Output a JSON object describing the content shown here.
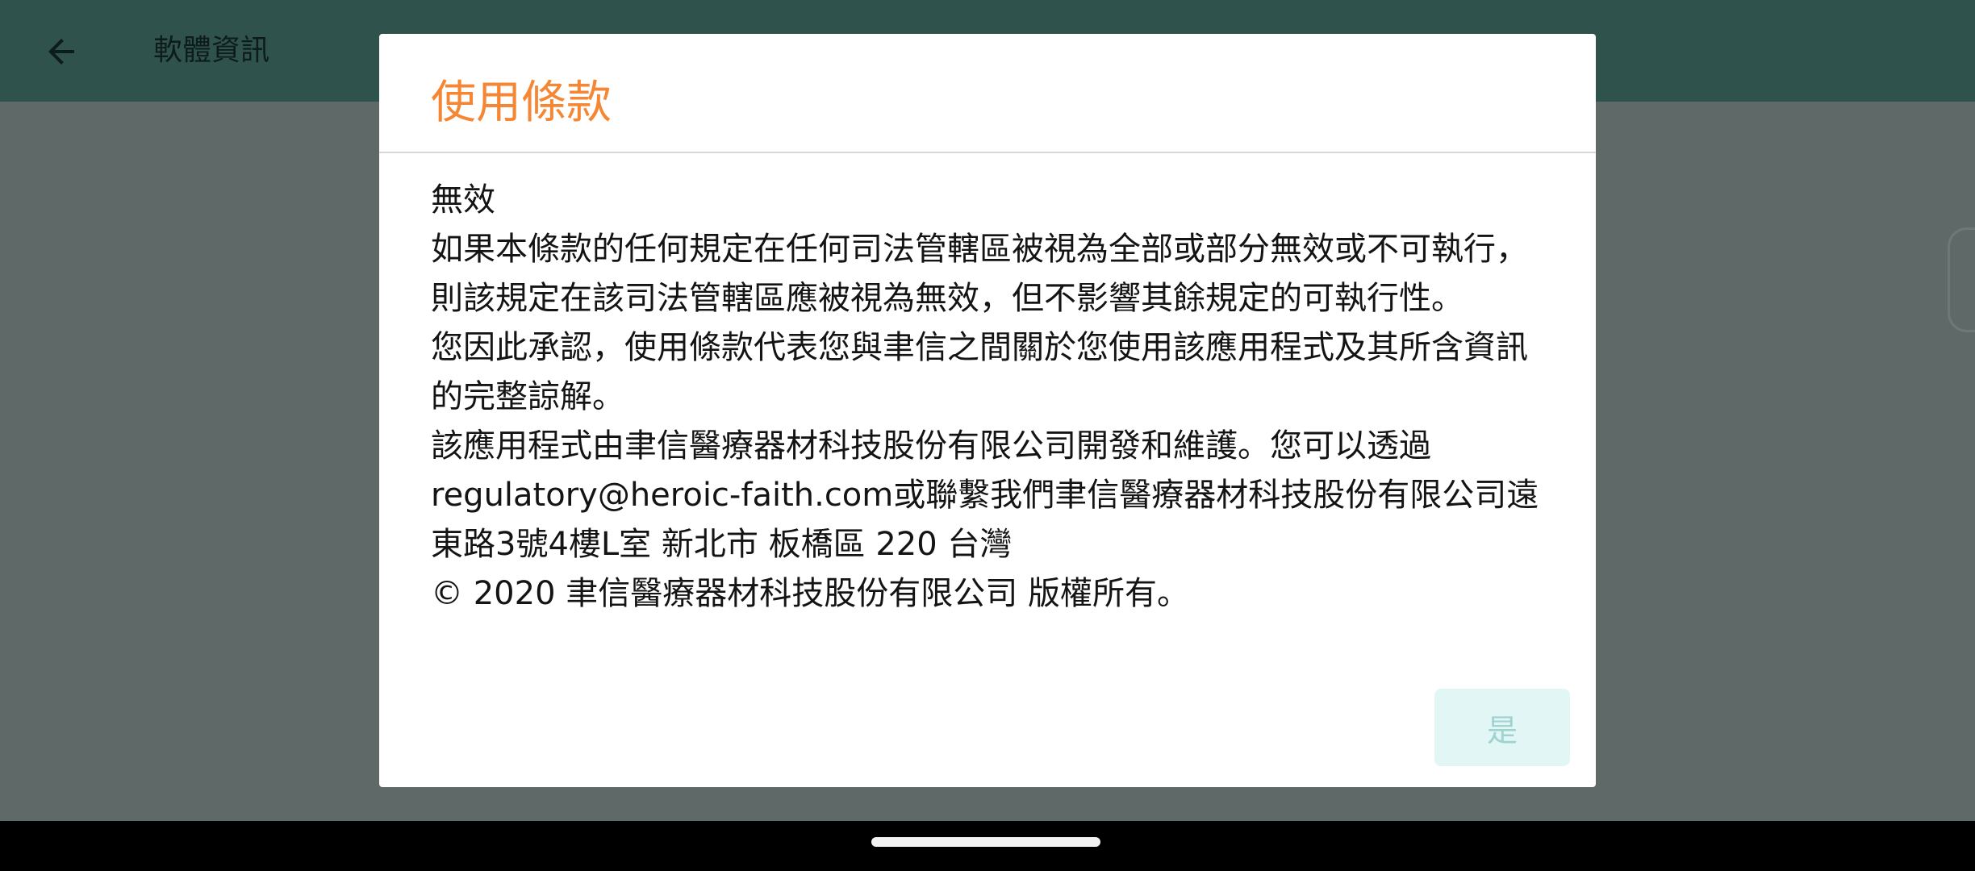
{
  "app_bar": {
    "back_icon": "arrow-left-icon",
    "title": "軟體資訊"
  },
  "dialog": {
    "title": "使用條款",
    "paragraphs": [
      "無效",
      "如果本條款的任何規定在任何司法管轄區被視為全部或部分無效或不可執行，則該規定在該司法管轄區應被視為無效，但不影響其餘規定的可執行性。",
      "您因此承認，使用條款代表您與聿信之間關於您使用該應用程式及其所含資訊的完整諒解。",
      "該應用程式由聿信醫療器材科技股份有限公司開發和維護。您可以透過regulatory@heroic-faith.com或聯繫我們聿信醫療器材科技股份有限公司遠東路3號4樓L室 新北市 板橋區 220 台灣",
      "© 2020 聿信醫療器材科技股份有限公司 版權所有。"
    ],
    "confirm_label": "是"
  },
  "colors": {
    "title_orange": "#f58634",
    "app_bar_teal": "#2f524d",
    "button_bg": "#e3f6f6",
    "button_text": "#9fd3d0"
  }
}
